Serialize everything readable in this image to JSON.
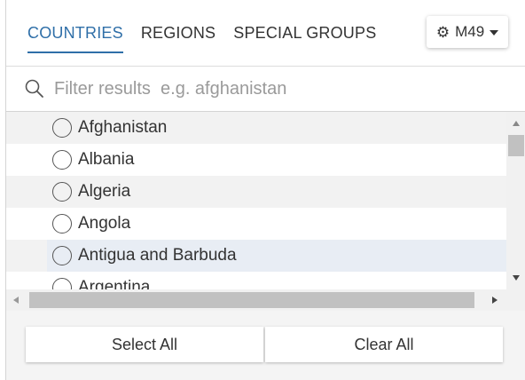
{
  "tabs": [
    {
      "label": "COUNTRIES",
      "active": true
    },
    {
      "label": "REGIONS",
      "active": false
    },
    {
      "label": "SPECIAL GROUPS",
      "active": false
    }
  ],
  "classification": {
    "label": "M49",
    "icon": "gear-icon"
  },
  "search": {
    "placeholder": "Filter results  e.g. afghanistan",
    "value": ""
  },
  "countries": [
    {
      "name": "Afghanistan",
      "selected": false
    },
    {
      "name": "Albania",
      "selected": false
    },
    {
      "name": "Algeria",
      "selected": false
    },
    {
      "name": "Angola",
      "selected": false
    },
    {
      "name": "Antigua and Barbuda",
      "selected": false,
      "hovered": true
    },
    {
      "name": "Argentina",
      "selected": false
    }
  ],
  "footer": {
    "select_all": "Select All",
    "clear_all": "Clear All"
  },
  "colors": {
    "accent": "#2f6fa8",
    "row_alt": "#f2f2f2",
    "row_hover": "#e8edf4"
  }
}
